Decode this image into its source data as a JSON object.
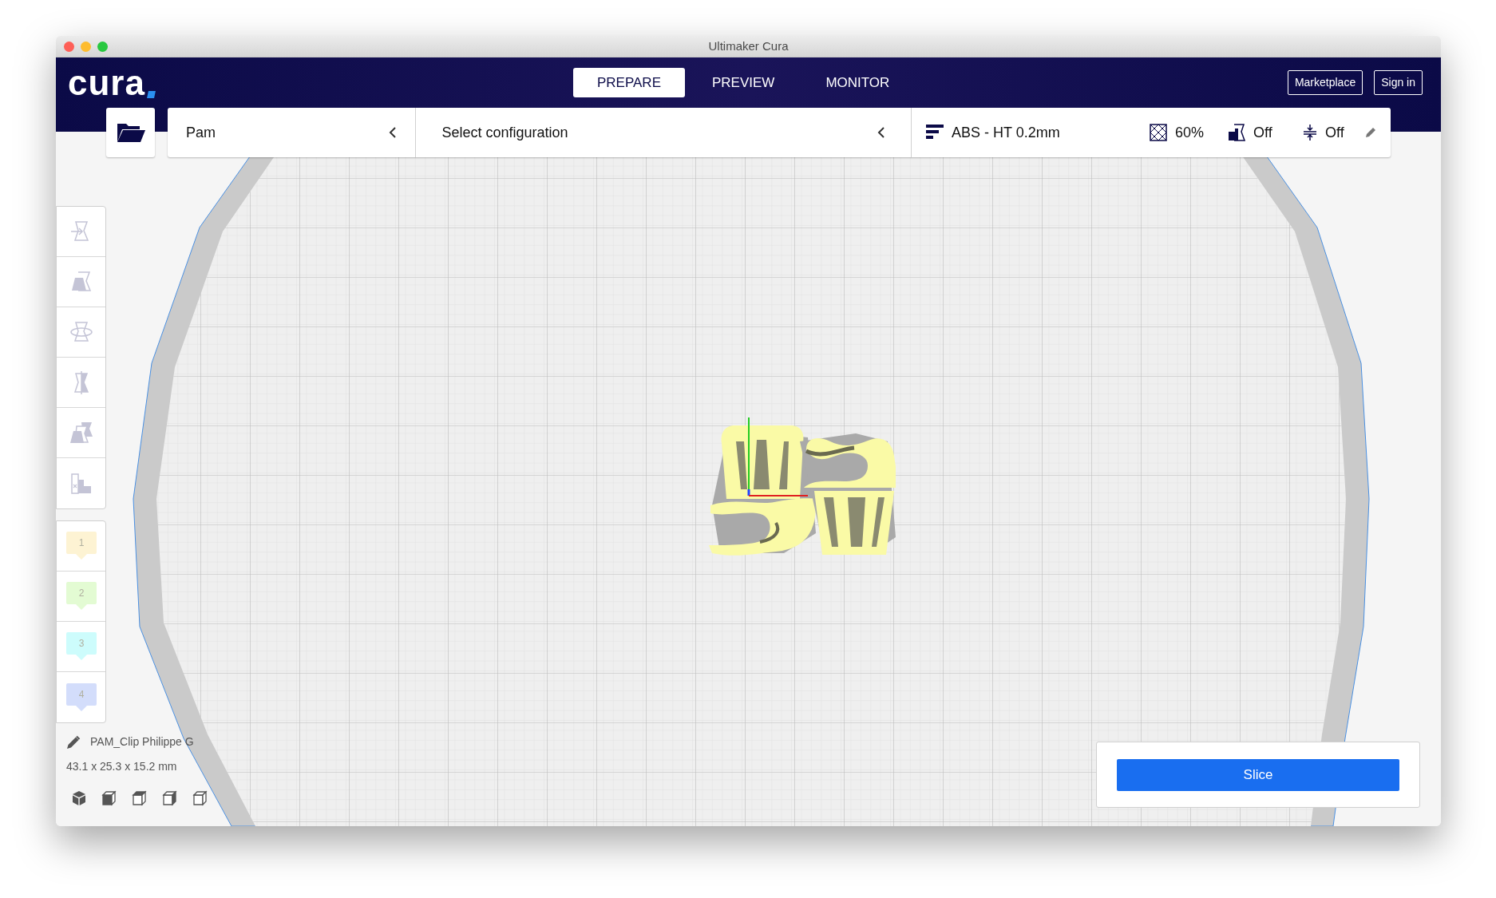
{
  "window": {
    "title": "Ultimaker Cura"
  },
  "logo": "cura",
  "tabs": [
    {
      "label": "PREPARE",
      "selected": true
    },
    {
      "label": "PREVIEW",
      "selected": false
    },
    {
      "label": "MONITOR",
      "selected": false
    }
  ],
  "header_buttons": [
    "Marketplace",
    "Sign in"
  ],
  "toolbar": {
    "printer": "Pam",
    "configuration": "Select configuration",
    "profile": "ABS - HT 0.2mm",
    "infill": "60%",
    "support": "Off",
    "adhesion": "Off"
  },
  "extruders": [
    {
      "label": "1",
      "color": "#fdf3d3"
    },
    {
      "label": "2",
      "color": "#e3fbd3"
    },
    {
      "label": "3",
      "color": "#cdfcfc"
    },
    {
      "label": "4",
      "color": "#d3ddfb"
    }
  ],
  "object_info": {
    "name": "PAM_Clip Philippe G",
    "dimensions": "43.1 x 25.3 x 15.2 mm"
  },
  "slice_button": "Slice"
}
